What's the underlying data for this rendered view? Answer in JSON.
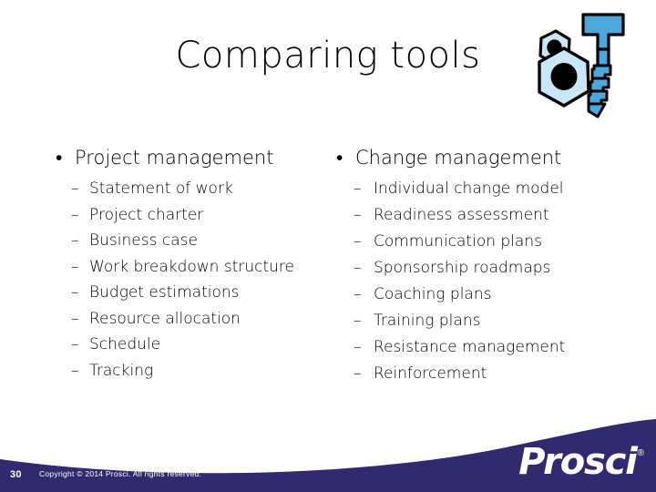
{
  "slide": {
    "title": "Comparing tools",
    "background_color": "#ffffff",
    "text_color": "#000000"
  },
  "artwork": {
    "name": "nuts-and-bolt-clipart",
    "nut_fill": "#c9e7f7",
    "bolt_fill": "#4aa8dc",
    "outline": "#000000",
    "hole_fill": "#000000"
  },
  "columns": [
    {
      "id": "project-management",
      "bullet": "•",
      "heading": "Project management",
      "sub_bullet": "–",
      "items": [
        "Statement of work",
        "Project charter",
        "Business case",
        "Work breakdown structure",
        "Budget estimations",
        "Resource allocation",
        "Schedule",
        "Tracking"
      ]
    },
    {
      "id": "change-management",
      "bullet": "•",
      "heading": "Change management",
      "sub_bullet": "–",
      "items": [
        "Individual change model",
        "Readiness assessment",
        "Communication plans",
        "Sponsorship roadmaps",
        "Coaching plans",
        "Training plans",
        "Resistance management",
        "Reinforcement"
      ]
    }
  ],
  "footer": {
    "page_number": "30",
    "copyright": "Copyright © 2014 Prosci. All rights reserved.",
    "logo_word": "Prosci",
    "logo_registered": "®",
    "band_color": "#312a6e",
    "text_color": "#ffffff"
  }
}
